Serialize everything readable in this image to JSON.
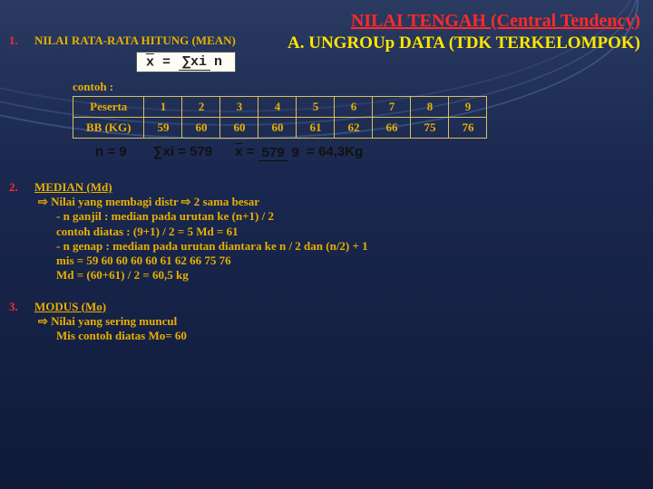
{
  "title1": "NILAI TENGAH (Central Tendency)",
  "title2": "A. UNGROUp      DATA (TDK TERKELOMPOK)",
  "sec1": {
    "num": "1.",
    "heading": "NILAI RATA-RATA HITUNG (MEAN)",
    "formula_label_x": "x",
    "contoh": "contoh :",
    "row_labels": [
      "Peserta",
      "BB (KG)"
    ],
    "peserta": [
      "1",
      "2",
      "3",
      "4",
      "5",
      "6",
      "7",
      "8",
      "9"
    ],
    "bb": [
      "59",
      "60",
      "60",
      "60",
      "61",
      "62",
      "66",
      "75",
      "76"
    ],
    "calc_n": "n = 9",
    "calc_sum": "∑xi = 579",
    "calc_res": "= 64,3Kg",
    "calc_frac_top": "579",
    "calc_frac_bot": "9"
  },
  "sec2": {
    "num": "2.",
    "heading": "MEDIAN (Md)",
    "l1": "⇨ Nilai yang membagi distr ⇨ 2 sama besar",
    "l2": "- n ganjil : median pada urutan ke (n+1) / 2",
    "l3": "contoh diatas : (9+1) / 2 = 5   Md = 61",
    "l4": "- n genap : median pada urutan diantara ke n / 2 dan (n/2) + 1",
    "l5": "mis =  59 60 60 60 60 61 62 66 75 76",
    "l6": "Md =  (60+61) / 2 = 60,5 kg"
  },
  "sec3": {
    "num": "3.",
    "heading": "MODUS  (Mo)",
    "l1": "⇨ Nilai yang sering muncul",
    "l2": "Mis contoh diatas Mo= 60"
  },
  "chart_data": {
    "type": "table",
    "title": "contoh :",
    "categories": [
      "1",
      "2",
      "3",
      "4",
      "5",
      "6",
      "7",
      "8",
      "9"
    ],
    "series": [
      {
        "name": "BB (KG)",
        "values": [
          59,
          60,
          60,
          60,
          61,
          62,
          66,
          75,
          76
        ]
      }
    ],
    "n": 9,
    "sum": 579,
    "mean": 64.3,
    "median_odd": 61,
    "median_even_example": 60.5,
    "mode": 60
  }
}
